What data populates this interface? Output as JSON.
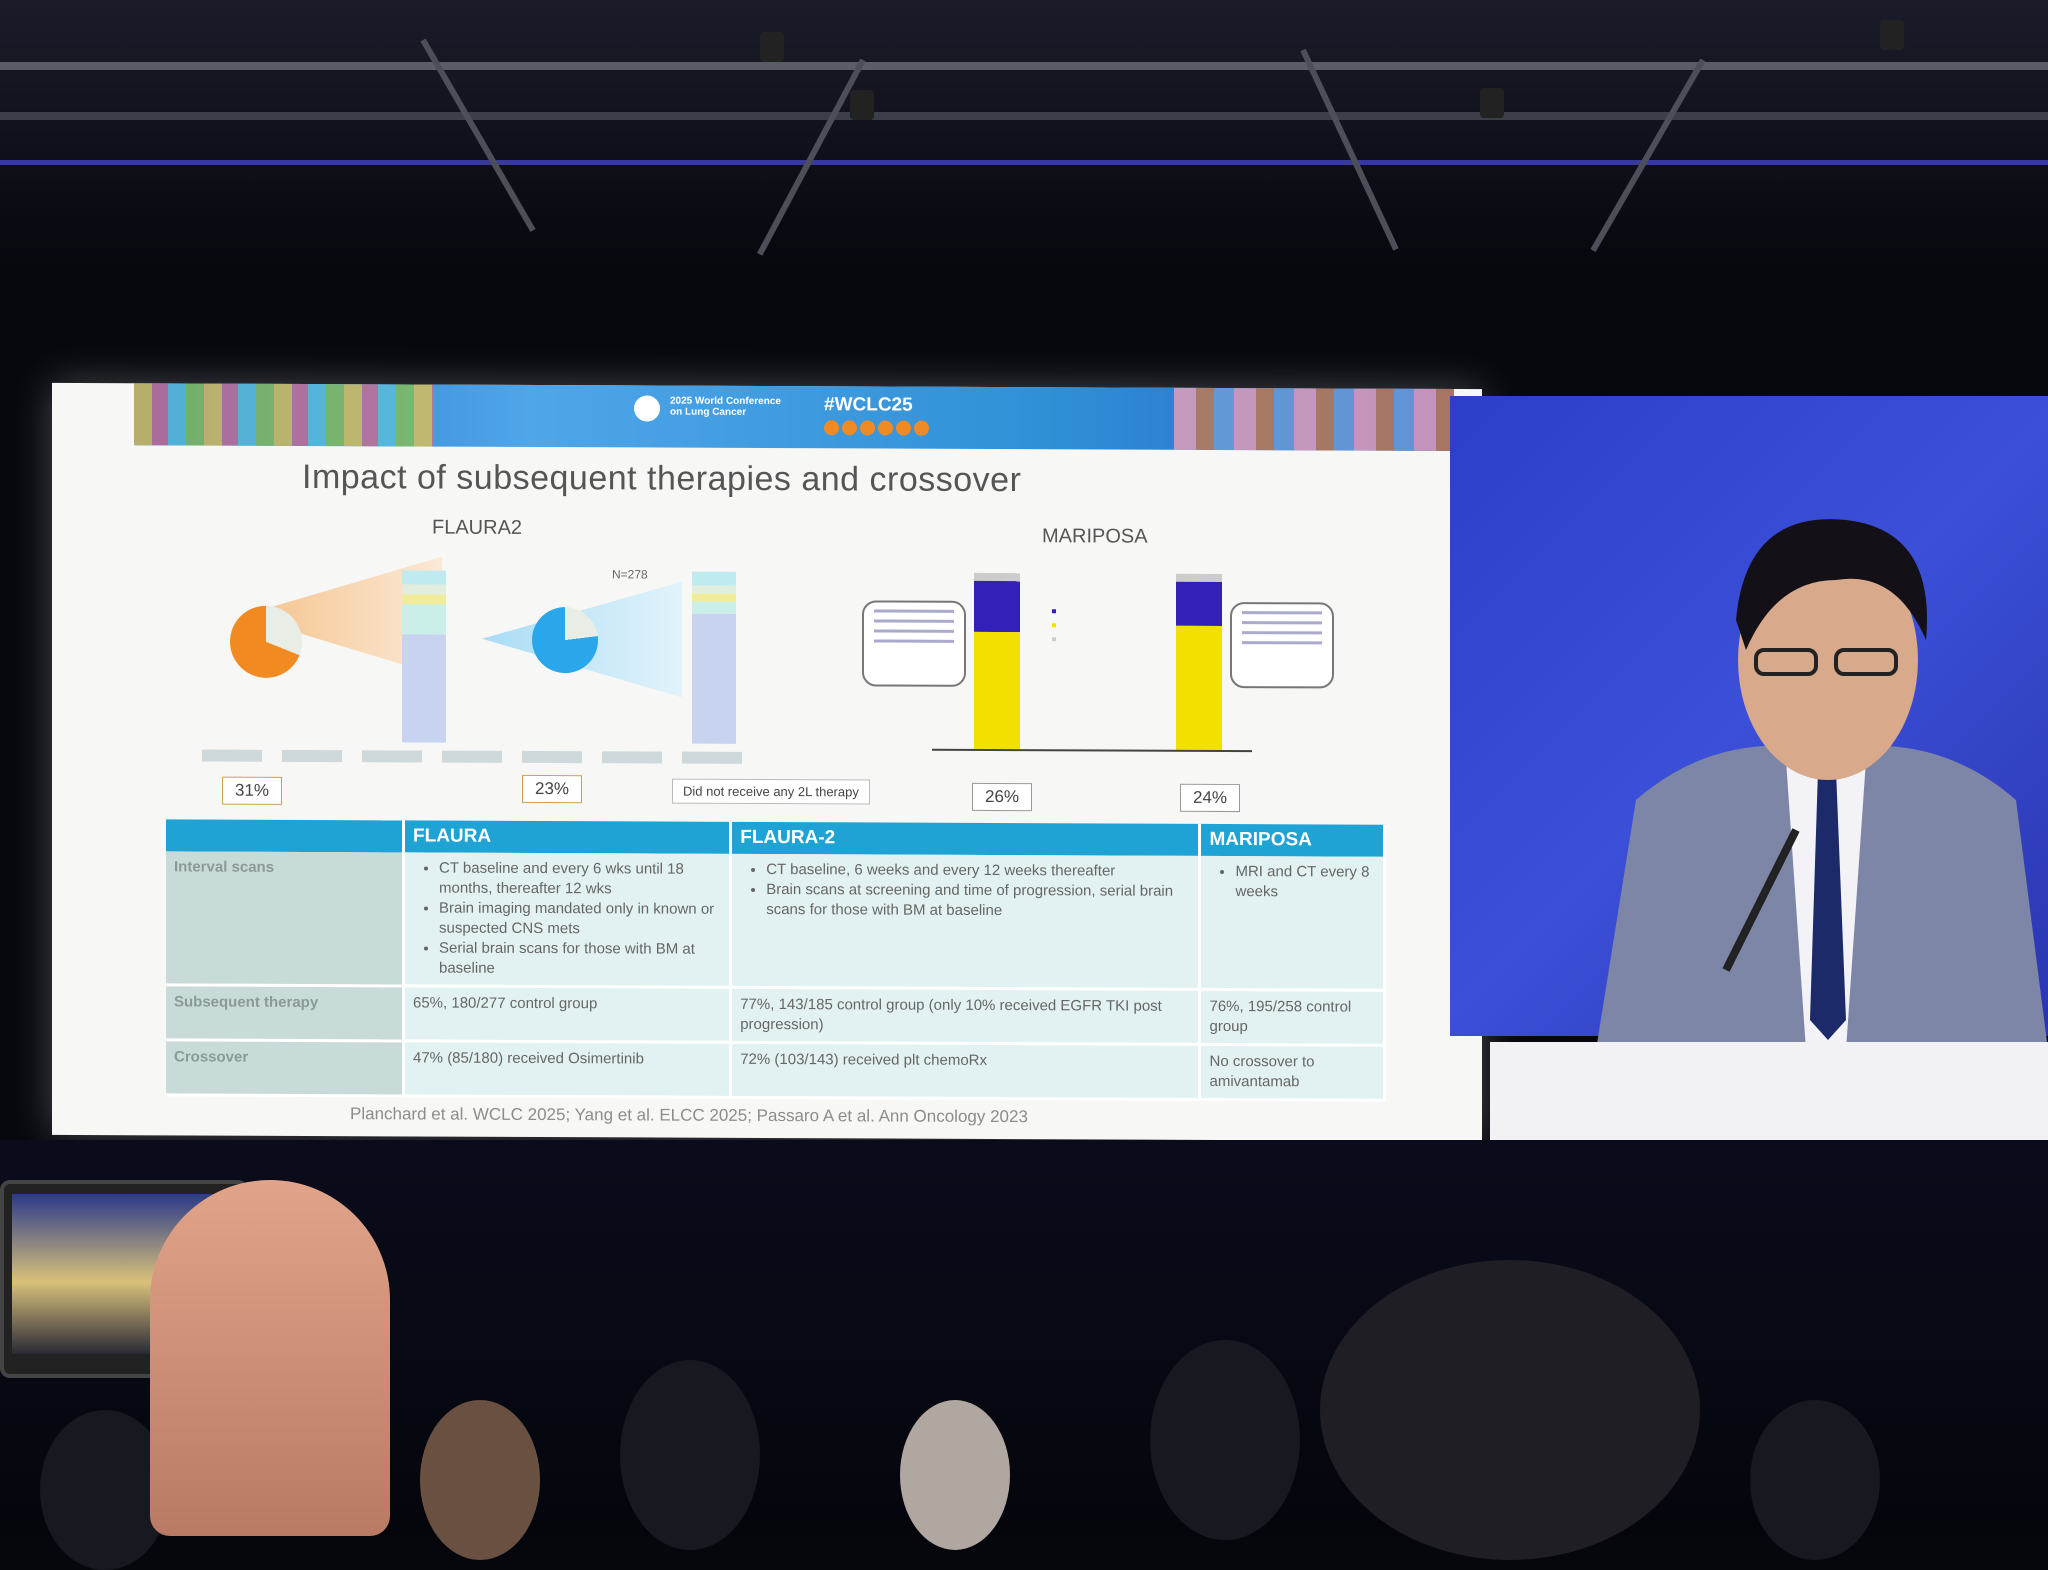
{
  "banner": {
    "conference": "2025 World Conference on Lung Cancer",
    "hashtag": "#WCLC25"
  },
  "slide": {
    "title": "Impact of subsequent therapies and crossover",
    "flaura2_label": "FLAURA2",
    "mariposa_label": "MARIPOSA",
    "flaura2_n": "N=278",
    "pct_osi_ct": "31%",
    "pct_osi_mono": "23%",
    "no_2l_note": "Did not receive any 2L therapy",
    "pct_mariposa_1": "26%",
    "pct_mariposa_2": "24%",
    "mariposa_bar_values": [
      {
        "blue": 29,
        "yellow": 71
      },
      {
        "blue": 25,
        "yellow": 75
      }
    ],
    "citation": "Planchard et al. WCLC 2025; Yang et al. ELCC 2025; Passaro A et al. Ann Oncology 2023"
  },
  "table": {
    "headers": [
      "",
      "FLAURA",
      "FLAURA-2",
      "MARIPOSA"
    ],
    "rows": [
      {
        "label": "Interval scans",
        "flaura": [
          "CT baseline and every 6 wks until 18 months, thereafter 12 wks",
          "Brain imaging mandated only in known or suspected CNS mets",
          "Serial brain scans for those with BM at baseline"
        ],
        "flaura2": [
          "CT baseline, 6 weeks and every 12 weeks thereafter",
          "Brain scans at screening and time of progression, serial brain scans for those with BM at baseline"
        ],
        "mariposa": [
          "MRI and CT every 8 weeks"
        ]
      },
      {
        "label": "Subsequent therapy",
        "flaura": "65%, 180/277 control group",
        "flaura2": "77%, 143/185 control group (only 10% received EGFR TKI post progression)",
        "mariposa": "76%, 195/258 control group"
      },
      {
        "label": "Crossover",
        "flaura": "47% (85/180) received Osimertinib",
        "flaura2": "72% (103/143) received plt chemoRx",
        "mariposa": "No crossover to amivantamab"
      }
    ]
  },
  "colors": {
    "table_header": "#1ea3d4",
    "pie_orange": "#f28a22",
    "pie_blue": "#2aa6ea",
    "bar_blue": "#3320b8",
    "bar_yellow": "#f2e000"
  }
}
